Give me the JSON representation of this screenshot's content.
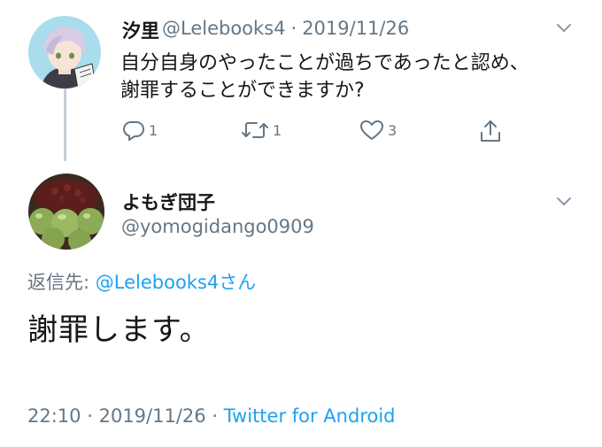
{
  "parent_tweet": {
    "display_name": "汐里",
    "handle": "@Lelebooks4",
    "separator": "·",
    "date": "2019/11/26",
    "text": "自分自身のやったことが過ちであったと認め、謝罪することができますか?",
    "actions": {
      "reply_count": "1",
      "retweet_count": "1",
      "like_count": "3",
      "reply_icon": "reply-icon",
      "retweet_icon": "retweet-icon",
      "like_icon": "heart-icon",
      "share_icon": "share-icon"
    }
  },
  "main_tweet": {
    "display_name": "よもぎ団子",
    "handle": "@yomogidango0909",
    "reply_to_prefix": "返信先:",
    "reply_to_handle": "@Lelebooks4さん",
    "text": "謝罪します。",
    "time": "22:10",
    "separator": "·",
    "date": "2019/11/26",
    "source": "Twitter for Android"
  },
  "colors": {
    "link": "#1da1f2",
    "secondary_text": "#657786",
    "primary_text": "#14171a",
    "thread_line": "#c4cfd6"
  }
}
